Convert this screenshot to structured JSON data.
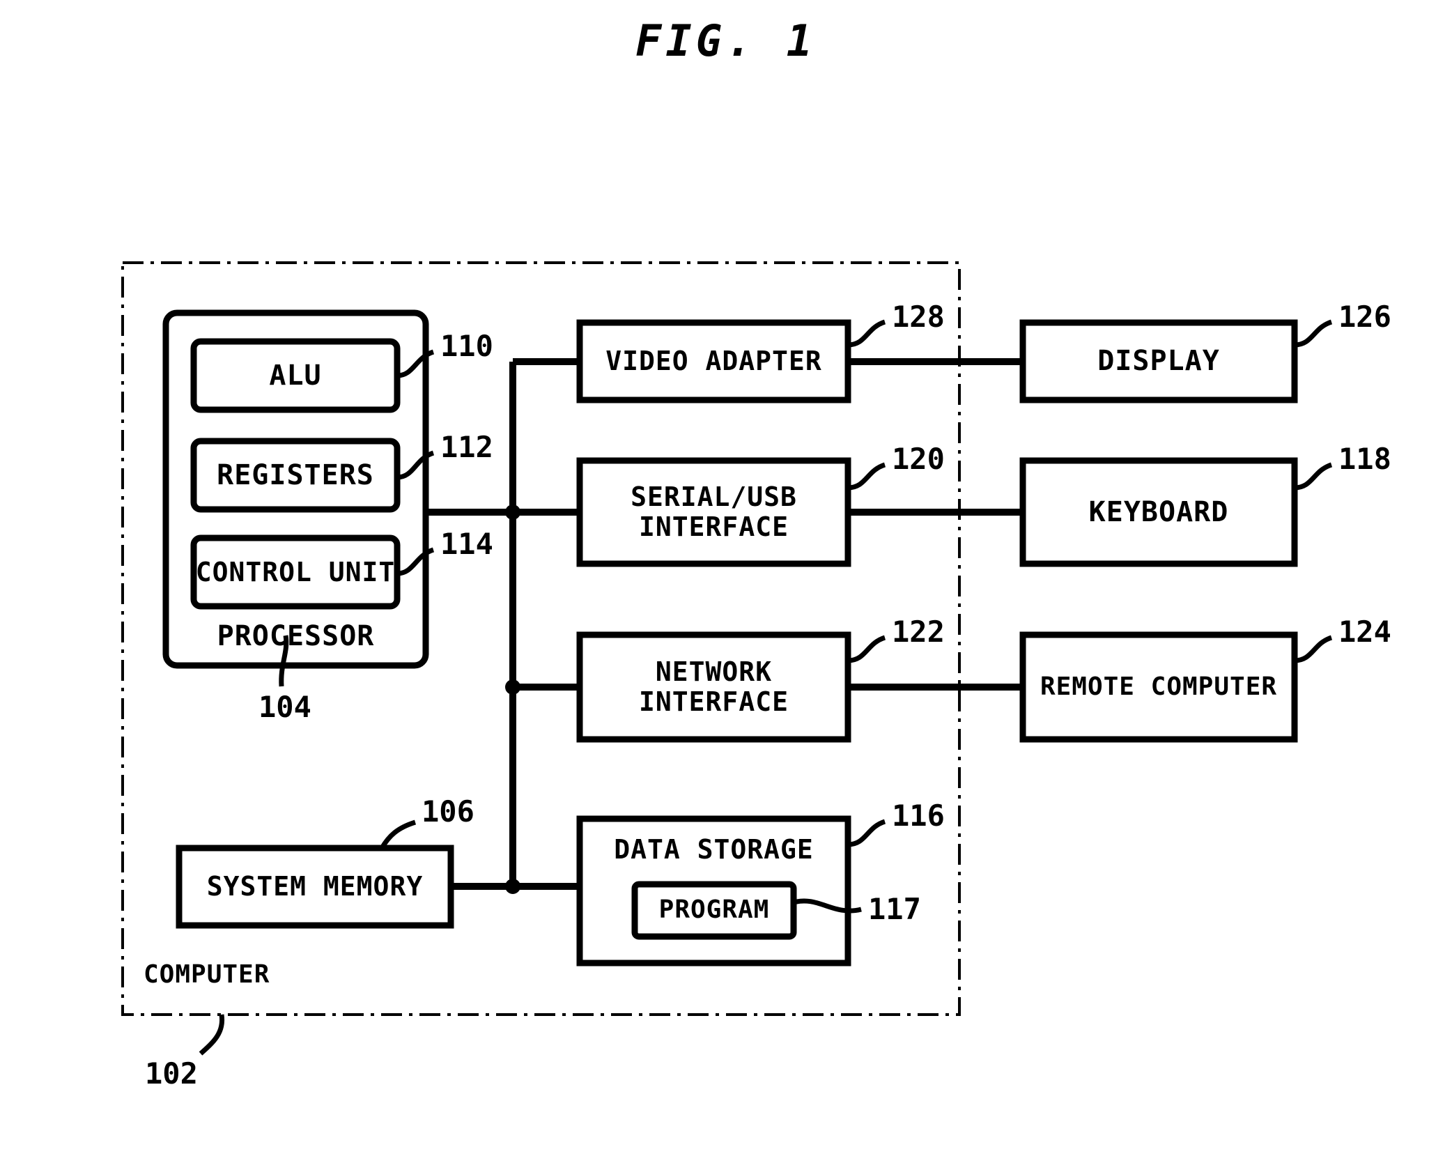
{
  "figure": {
    "title": "FIG. 1"
  },
  "outer": {
    "label": "COMPUTER",
    "ref": "102"
  },
  "processor": {
    "label": "PROCESSOR",
    "ref": "104",
    "components": [
      {
        "label": "ALU",
        "ref": "110"
      },
      {
        "label": "REGISTERS",
        "ref": "112"
      },
      {
        "label": "CONTROL UNIT",
        "ref": "114"
      }
    ]
  },
  "memory": {
    "label": "SYSTEM MEMORY",
    "ref": "106"
  },
  "interfaces": [
    {
      "label": "VIDEO ADAPTER",
      "ref": "128",
      "peripheral": {
        "label": "DISPLAY",
        "ref": "126"
      }
    },
    {
      "label": "SERIAL/USB\nINTERFACE",
      "ref": "120",
      "peripheral": {
        "label": "KEYBOARD",
        "ref": "118"
      }
    },
    {
      "label": "NETWORK\nINTERFACE",
      "ref": "122",
      "peripheral": {
        "label": "REMOTE COMPUTER",
        "ref": "124"
      }
    }
  ],
  "storage": {
    "label": "DATA STORAGE",
    "ref": "116",
    "program": {
      "label": "PROGRAM",
      "ref": "117"
    }
  },
  "colors": {
    "ink": "#000000",
    "paper": "#ffffff"
  }
}
